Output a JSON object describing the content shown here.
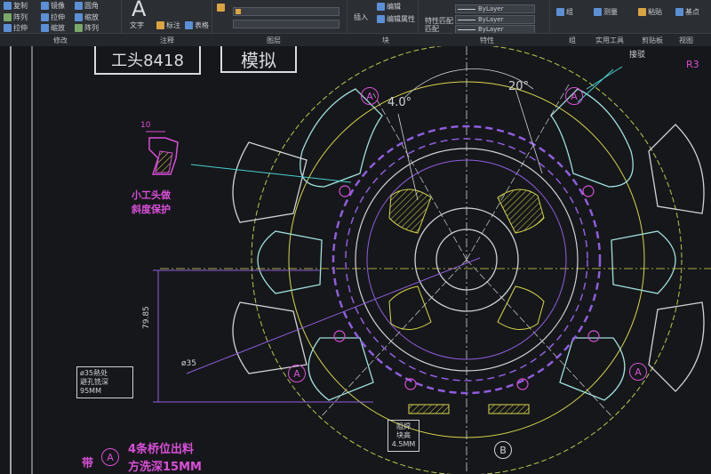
{
  "ribbon": {
    "tools": {
      "copy": "复制",
      "mirror": "镜像",
      "fillet": "圆角",
      "array": "阵列",
      "stretch": "拉伸",
      "scale": "缩放",
      "text": "文字",
      "dimension": "标注",
      "table": "表格",
      "insert": "插入",
      "edit": "编辑",
      "edit_attribute": "编辑属性",
      "match_properties": "特性匹配",
      "match": "匹配",
      "group": "组",
      "measure": "测量",
      "paste": "粘贴",
      "base": "基点",
      "view": "视图"
    },
    "panels": {
      "modify": "修改",
      "annotation": "注释",
      "layers": "图层",
      "block": "块",
      "properties": "特性",
      "groups": "组",
      "utilities": "实用工具",
      "clipboard": "剪贴板",
      "view": "视图"
    },
    "bylayer": "ByLayer"
  },
  "drawing": {
    "title_box_1": "工头8418",
    "title_box_2": "模拟",
    "dim_10": "10",
    "note_small_head": [
      "小工头做",
      "斜度保护"
    ],
    "angle_40": "4.0°",
    "angle_20": "20°",
    "label_connect": "接驳",
    "label_r3": "R3",
    "dim_79_85": "79.85",
    "dim_phi35": "ø35",
    "note_phi35": [
      "ø35熱处",
      "避孔铣深",
      "95MM"
    ],
    "note_bridge_prefix": "带",
    "circle_a": "A",
    "circle_b": "B",
    "note_bridge_line1": "4条桥位出料",
    "note_bridge_line2": "方洗深15MM",
    "note_block": [
      "阻焊",
      "块高",
      "4.5MM"
    ]
  },
  "colors": {
    "magenta": "#d94fd9",
    "cyan": "#48d1d1",
    "yellow": "#d8d84a",
    "purple": "#8f5de0",
    "white": "#cfd2d6"
  }
}
